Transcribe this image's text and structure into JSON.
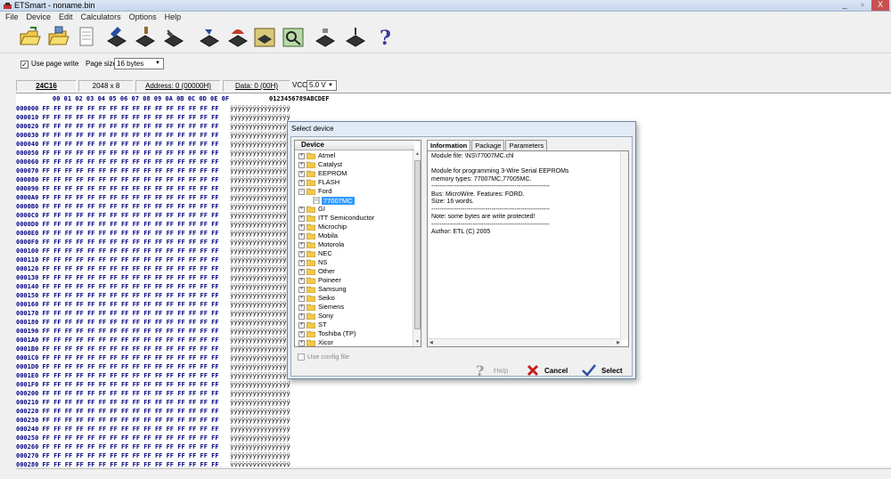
{
  "window": {
    "title": "ETSmart - noname.bin",
    "minimize": "_",
    "restore": "▫",
    "close": "X"
  },
  "menu": [
    "File",
    "Device",
    "Edit",
    "Calculators",
    "Options",
    "Help"
  ],
  "toolbar": {
    "buttons": [
      "open-folder-icon",
      "save-icon",
      "document-icon",
      "read-chip-icon",
      "write-chip-icon",
      "verify-chip-icon",
      "erase-chip-icon",
      "blank-check-icon",
      "program-chip-icon",
      "device-info-icon",
      "chip-read-icon",
      "chip-write-icon",
      "help-icon"
    ]
  },
  "options": {
    "use_page_write": "Use page write",
    "use_page_write_checked": true,
    "page_size_label": "Page size",
    "page_size_value": "16 bytes"
  },
  "infobar": {
    "chip": "24C16",
    "organization": "2048 x 8",
    "address": "Address: 0 (00000H)",
    "data": "Data: 0 (00H)",
    "vcc_label": "VCC",
    "vcc_value": "5.0 V"
  },
  "hex": {
    "header": "00 01 02 03 04 05 06 07 08 09 0A 0B 0C 0D 0E 0F",
    "ascii_header": "0123456789ABCDEF",
    "byte": "FF",
    "ascii": "ÿÿÿÿÿÿÿÿÿÿÿÿÿÿÿÿ",
    "addresses": [
      "000000",
      "000010",
      "000020",
      "000030",
      "000040",
      "000050",
      "000060",
      "000070",
      "000080",
      "000090",
      "0000A0",
      "0000B0",
      "0000C0",
      "0000D0",
      "0000E0",
      "0000F0",
      "000100",
      "000110",
      "000120",
      "000130",
      "000140",
      "000150",
      "000160",
      "000170",
      "000180",
      "000190",
      "0001A0",
      "0001B0",
      "0001C0",
      "0001D0",
      "0001E0",
      "0001F0",
      "000200",
      "000210",
      "000220",
      "000230",
      "000240",
      "000250",
      "000260",
      "000270",
      "000280"
    ]
  },
  "dialog": {
    "title": "Select device",
    "tree_header": "Device",
    "tree": [
      "Atmel",
      "Catalyst",
      "EEPROM",
      "FLASH",
      "Ford",
      "GI",
      "ITT Semiconductor",
      "Microchip",
      "Mobila",
      "Motorola",
      "NEC",
      "NS",
      "Other",
      "Poineer",
      "Samsung",
      "Seiko",
      "Siemens",
      "Sony",
      "ST",
      "Toshiba (TP)",
      "Xicor"
    ],
    "expanded": "Ford",
    "selected_child": "77007MC",
    "tabs": [
      "Information",
      "Package",
      "Parameters"
    ],
    "active_tab": "Information",
    "info_lines": [
      "Module file: \\NS\\77007MC.chl",
      "",
      "Module for programming 3-Wire Serial EEPROMs",
      "memory types: 77007MC,77005MC.",
      "---------------------------------------------------------",
      "Bus: MicroWire. Features: FORD.",
      "Size: 16 words.",
      "---------------------------------------------------------",
      "Note: some bytes are write protected!",
      "---------------------------------------------------------",
      "Author: ETL (C) 2005"
    ],
    "use_config_file": "Use config file",
    "help_label": "Help",
    "cancel_label": "Cancel",
    "select_label": "Select"
  },
  "colors": {
    "hex_blue": "#000080",
    "selection": "#3399ff",
    "folder": "#f2c94c"
  }
}
